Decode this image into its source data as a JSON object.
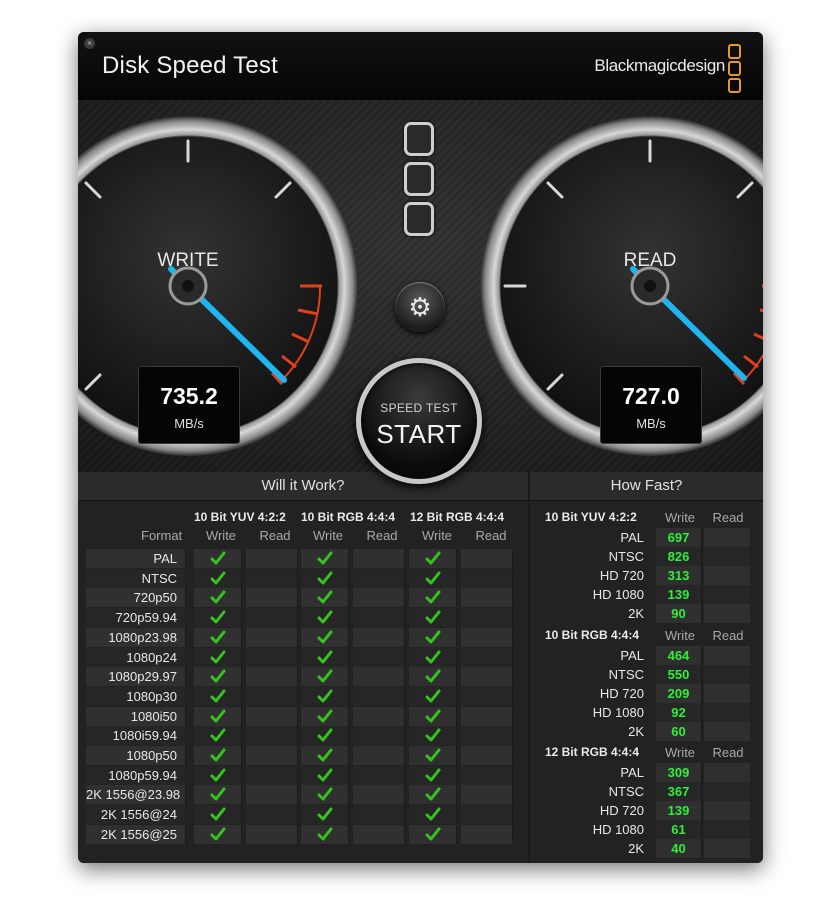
{
  "window": {
    "title": "Disk Speed Test",
    "brand": "Blackmagicdesign",
    "close_glyph": "×"
  },
  "gauges": {
    "write": {
      "label": "WRITE",
      "value": "735.2",
      "unit": "MB/s"
    },
    "read": {
      "label": "READ",
      "value": "727.0",
      "unit": "MB/s"
    }
  },
  "start_button": {
    "subtitle": "SPEED TEST",
    "label": "START"
  },
  "settings_icon": "gear-icon",
  "will_it_work": {
    "title": "Will it Work?",
    "format_header": "Format",
    "groups": [
      {
        "name": "10 Bit YUV 4:2:2",
        "write_label": "Write",
        "read_label": "Read"
      },
      {
        "name": "10 Bit RGB 4:4:4",
        "write_label": "Write",
        "read_label": "Read"
      },
      {
        "name": "12 Bit RGB 4:4:4",
        "write_label": "Write",
        "read_label": "Read"
      }
    ],
    "formats": [
      "PAL",
      "NTSC",
      "720p50",
      "720p59.94",
      "1080p23.98",
      "1080p24",
      "1080p29.97",
      "1080p30",
      "1080i50",
      "1080i59.94",
      "1080p50",
      "1080p59.94",
      "2K 1556@23.98",
      "2K 1556@24",
      "2K 1556@25"
    ],
    "check_color": "#35c41e"
  },
  "how_fast": {
    "title": "How Fast?",
    "groups": [
      {
        "name": "10 Bit YUV 4:2:2",
        "write_label": "Write",
        "read_label": "Read",
        "rows": [
          {
            "label": "PAL",
            "write": "697"
          },
          {
            "label": "NTSC",
            "write": "826"
          },
          {
            "label": "HD 720",
            "write": "313"
          },
          {
            "label": "HD 1080",
            "write": "139"
          },
          {
            "label": "2K",
            "write": "90"
          }
        ]
      },
      {
        "name": "10 Bit RGB 4:4:4",
        "write_label": "Write",
        "read_label": "Read",
        "rows": [
          {
            "label": "PAL",
            "write": "464"
          },
          {
            "label": "NTSC",
            "write": "550"
          },
          {
            "label": "HD 720",
            "write": "209"
          },
          {
            "label": "HD 1080",
            "write": "92"
          },
          {
            "label": "2K",
            "write": "60"
          }
        ]
      },
      {
        "name": "12 Bit RGB 4:4:4",
        "write_label": "Write",
        "read_label": "Read",
        "rows": [
          {
            "label": "PAL",
            "write": "309"
          },
          {
            "label": "NTSC",
            "write": "367"
          },
          {
            "label": "HD 720",
            "write": "139"
          },
          {
            "label": "HD 1080",
            "write": "61"
          },
          {
            "label": "2K",
            "write": "40"
          }
        ]
      }
    ],
    "value_color": "#2ef03a"
  },
  "colors": {
    "accent_needle": "#1fb6f0",
    "redline": "#e0401a",
    "brand_orange": "#e69a2e"
  }
}
